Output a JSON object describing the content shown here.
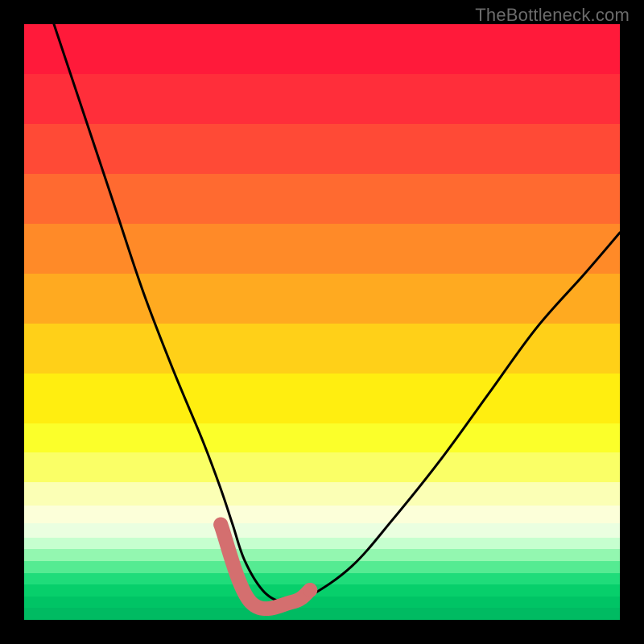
{
  "watermark": "TheBottleneck.com",
  "chart_data": {
    "type": "line",
    "title": "",
    "xlabel": "",
    "ylabel": "",
    "xlim": [
      0,
      100
    ],
    "ylim": [
      0,
      100
    ],
    "series": [
      {
        "name": "curve",
        "x": [
          5,
          10,
          15,
          20,
          25,
          30,
          33,
          35,
          37,
          40,
          43,
          45,
          48,
          55,
          62,
          70,
          78,
          86,
          94,
          100
        ],
        "y": [
          100,
          85,
          70,
          55,
          42,
          30,
          22,
          16,
          10,
          5,
          3,
          3,
          4,
          9,
          17,
          27,
          38,
          49,
          58,
          65
        ]
      }
    ],
    "highlight_band": {
      "x0": 33,
      "x1": 48,
      "y_level": 3
    },
    "gradient_bands": [
      {
        "color": "#ff1a3a",
        "height_pct": 8.5
      },
      {
        "color": "#ff2e3a",
        "height_pct": 8.5
      },
      {
        "color": "#ff4a36",
        "height_pct": 8.5
      },
      {
        "color": "#ff6a30",
        "height_pct": 8.5
      },
      {
        "color": "#ff8a28",
        "height_pct": 8.5
      },
      {
        "color": "#ffaa20",
        "height_pct": 8.5
      },
      {
        "color": "#ffd018",
        "height_pct": 8.5
      },
      {
        "color": "#ffee10",
        "height_pct": 8.5
      },
      {
        "color": "#fbff2a",
        "height_pct": 5.0
      },
      {
        "color": "#faff66",
        "height_pct": 5.0
      },
      {
        "color": "#fbffb5",
        "height_pct": 4.0
      },
      {
        "color": "#fcffd9",
        "height_pct": 3.0
      },
      {
        "color": "#eaffe0",
        "height_pct": 2.5
      },
      {
        "color": "#c6ffcf",
        "height_pct": 2.0
      },
      {
        "color": "#93f7b0",
        "height_pct": 2.0
      },
      {
        "color": "#55eb92",
        "height_pct": 2.0
      },
      {
        "color": "#1fdc7a",
        "height_pct": 2.0
      },
      {
        "color": "#07cf6b",
        "height_pct": 2.0
      },
      {
        "color": "#00c465",
        "height_pct": 2.0
      },
      {
        "color": "#00bb62",
        "height_pct": 2.0
      }
    ],
    "colors": {
      "curve": "#000000",
      "highlight": "#d46f6f",
      "background_black": "#000000"
    }
  }
}
